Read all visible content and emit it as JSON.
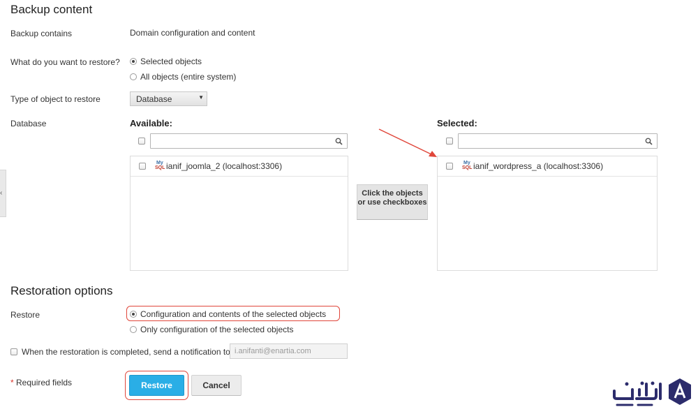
{
  "backup": {
    "title": "Backup content",
    "contains_label": "Backup contains",
    "contains_value": "Domain configuration and content",
    "restore_what_label": "What do you want to restore?",
    "option_selected": "Selected objects",
    "option_all": "All objects (entire system)",
    "type_label": "Type of object to restore",
    "type_value": "Database",
    "db_label": "Database"
  },
  "available": {
    "heading": "Available:",
    "search_placeholder": "",
    "items": [
      "ianif_joomla_2 (localhost:3306)"
    ]
  },
  "selected": {
    "heading": "Selected:",
    "search_placeholder": "",
    "items": [
      "ianif_wordpress_a (localhost:3306)"
    ]
  },
  "move_hint": "Click the objects or use checkboxes",
  "restoration": {
    "title": "Restoration options",
    "restore_label": "Restore",
    "option_config_content": "Configuration and contents of the selected objects",
    "option_config_only": "Only configuration of the selected objects",
    "notify_label": "When the restoration is completed, send a notification to",
    "notify_email": "i.anifanti@enartia.com"
  },
  "footer": {
    "required_star": "*",
    "required_text": "Required fields",
    "restore_button": "Restore",
    "cancel_button": "Cancel"
  },
  "colors": {
    "primary_button": "#2aaee6",
    "highlight_outline": "#e0463a",
    "logo": "#2c2c6c"
  },
  "icons": {
    "search": "magnifier-icon",
    "db": "mysql-icon",
    "collapse": "chevron-left-icon"
  }
}
